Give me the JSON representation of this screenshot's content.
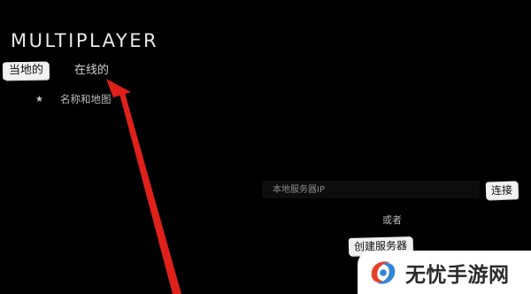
{
  "screen": {
    "title": "MULTIPLAYER"
  },
  "tabs": [
    {
      "label": "当地的",
      "active": true
    },
    {
      "label": "在线的",
      "active": false
    }
  ],
  "server_list": {
    "header_icon": "star-icon",
    "header_label": "名称和地图"
  },
  "join": {
    "ip_placeholder": "本地服务器IP",
    "connect_label": "连接",
    "or_label": "或者",
    "create_label": "创建服务器"
  },
  "annotation": {
    "arrow_color": "#e0201a"
  },
  "watermark": {
    "text": "无忧手游网",
    "logo_colors": [
      "#e8402a",
      "#2f86d6"
    ]
  },
  "colors": {
    "background": "#000000",
    "label_bg": "#f2f2f2",
    "text": "#d0d0d0"
  }
}
